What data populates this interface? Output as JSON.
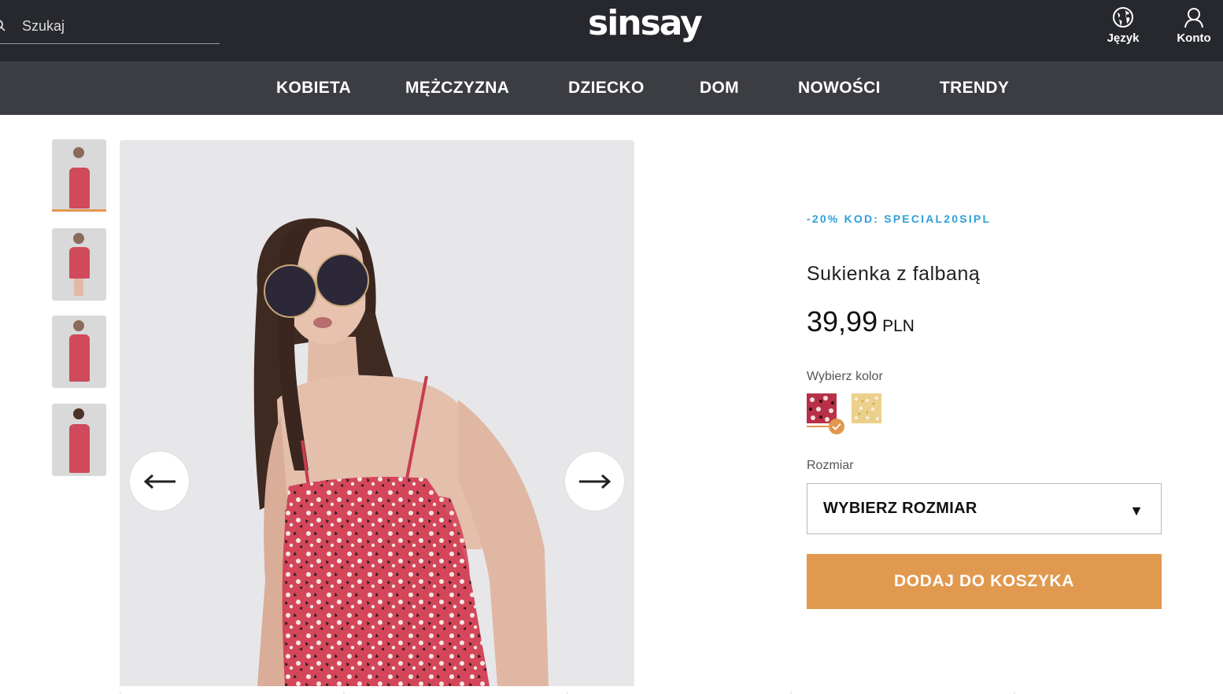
{
  "header": {
    "search_placeholder": "Szukaj",
    "logo_text": "sinsay",
    "language_label": "Język",
    "account_label": "Konto"
  },
  "nav": {
    "items": [
      "KOBIETA",
      "MĘŻCZYZNA",
      "DZIECKO",
      "DOM",
      "NOWOŚCI",
      "TRENDY"
    ]
  },
  "gallery": {
    "thumbnail_count": 4,
    "active_index": 0
  },
  "product": {
    "promo": "-20% KOD: SPECIAL20SIPL",
    "title": "Sukienka z falbaną",
    "price": "39,99",
    "currency": "PLN",
    "color_label": "Wybierz kolor",
    "colors": [
      "red-floral",
      "yellow-floral"
    ],
    "selected_color": "red-floral",
    "size_label": "Rozmiar",
    "size_placeholder": "WYBIERZ ROZMIAR",
    "add_to_cart": "DODAJ DO KOSZYKA"
  },
  "colors": {
    "topbar": "#26282d",
    "nav": "#3b3d43",
    "accent": "#e1994f",
    "promo": "#2f9fd8"
  }
}
